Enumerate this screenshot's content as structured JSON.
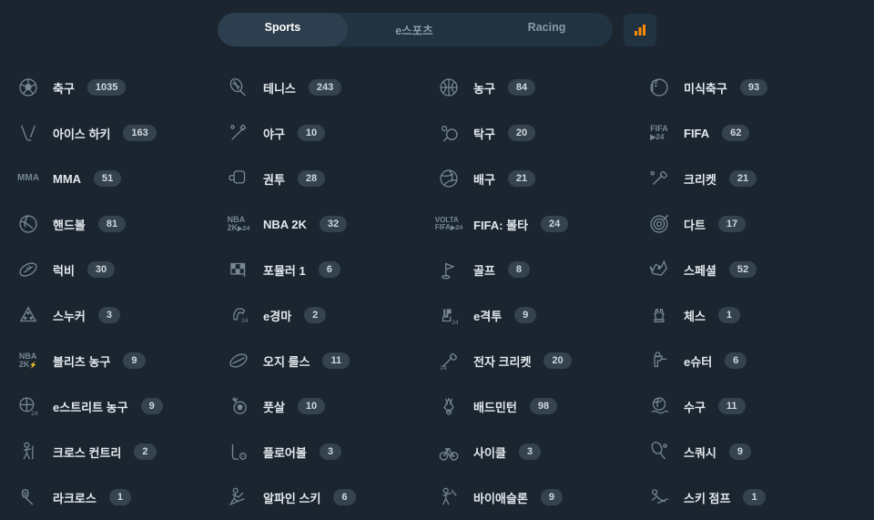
{
  "tabs": [
    {
      "label": "Sports",
      "active": true
    },
    {
      "label": "e스포츠",
      "active": false
    },
    {
      "label": "Racing",
      "active": false
    }
  ],
  "sports": [
    {
      "label": "축구",
      "count": "1035",
      "icon": "soccer"
    },
    {
      "label": "테니스",
      "count": "243",
      "icon": "tennis"
    },
    {
      "label": "농구",
      "count": "84",
      "icon": "basketball"
    },
    {
      "label": "미식축구",
      "count": "93",
      "icon": "amfootball"
    },
    {
      "label": "아이스 하키",
      "count": "163",
      "icon": "hockey"
    },
    {
      "label": "야구",
      "count": "10",
      "icon": "baseball"
    },
    {
      "label": "탁구",
      "count": "20",
      "icon": "tabletennis"
    },
    {
      "label": "FIFA",
      "count": "62",
      "icon": "fifa24"
    },
    {
      "label": "MMA",
      "count": "51",
      "icon": "mma"
    },
    {
      "label": "권투",
      "count": "28",
      "icon": "boxing"
    },
    {
      "label": "배구",
      "count": "21",
      "icon": "volleyball"
    },
    {
      "label": "크리켓",
      "count": "21",
      "icon": "cricket"
    },
    {
      "label": "핸드볼",
      "count": "81",
      "icon": "handball"
    },
    {
      "label": "NBA 2K",
      "count": "32",
      "icon": "nba2k"
    },
    {
      "label": "FIFA: 볼타",
      "count": "24",
      "icon": "voltafifa"
    },
    {
      "label": "다트",
      "count": "17",
      "icon": "darts"
    },
    {
      "label": "럭비",
      "count": "30",
      "icon": "rugby"
    },
    {
      "label": "포뮬러 1",
      "count": "6",
      "icon": "f1"
    },
    {
      "label": "골프",
      "count": "8",
      "icon": "golf"
    },
    {
      "label": "스페셜",
      "count": "52",
      "icon": "special"
    },
    {
      "label": "스누커",
      "count": "3",
      "icon": "snooker"
    },
    {
      "label": "e경마",
      "count": "2",
      "icon": "ehorse"
    },
    {
      "label": "e격투",
      "count": "9",
      "icon": "efight"
    },
    {
      "label": "체스",
      "count": "1",
      "icon": "chess"
    },
    {
      "label": "블리츠 농구",
      "count": "9",
      "icon": "blitzbb"
    },
    {
      "label": "오지 룰스",
      "count": "11",
      "icon": "aussie"
    },
    {
      "label": "전자 크리켓",
      "count": "20",
      "icon": "ecricket"
    },
    {
      "label": "e슈터",
      "count": "6",
      "icon": "eshooter"
    },
    {
      "label": "e스트리트 농구",
      "count": "9",
      "icon": "estreetbb"
    },
    {
      "label": "풋살",
      "count": "10",
      "icon": "futsal"
    },
    {
      "label": "배드민턴",
      "count": "98",
      "icon": "badminton"
    },
    {
      "label": "수구",
      "count": "11",
      "icon": "waterpolo"
    },
    {
      "label": "크로스 컨트리",
      "count": "2",
      "icon": "crosscountry"
    },
    {
      "label": "플로어볼",
      "count": "3",
      "icon": "floorball"
    },
    {
      "label": "사이클",
      "count": "3",
      "icon": "cycling"
    },
    {
      "label": "스쿼시",
      "count": "9",
      "icon": "squash"
    },
    {
      "label": "라크로스",
      "count": "1",
      "icon": "lacrosse"
    },
    {
      "label": "알파인 스키",
      "count": "6",
      "icon": "alpine"
    },
    {
      "label": "바이애슬론",
      "count": "9",
      "icon": "biathlon"
    },
    {
      "label": "스키 점프",
      "count": "1",
      "icon": "skijump"
    }
  ]
}
